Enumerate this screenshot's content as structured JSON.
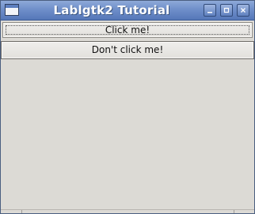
{
  "window": {
    "title": "Lablgtk2 Tutorial",
    "icons": {
      "app": "window-app-icon",
      "minimize": "minimize-icon",
      "maximize": "maximize-icon",
      "close": "close-icon"
    }
  },
  "buttons": {
    "click_me": "Click me!",
    "dont_click_me": "Don't click me!"
  },
  "colors": {
    "titlebar": "#6f8fca",
    "background": "#dcdad5",
    "text": "#111111"
  }
}
